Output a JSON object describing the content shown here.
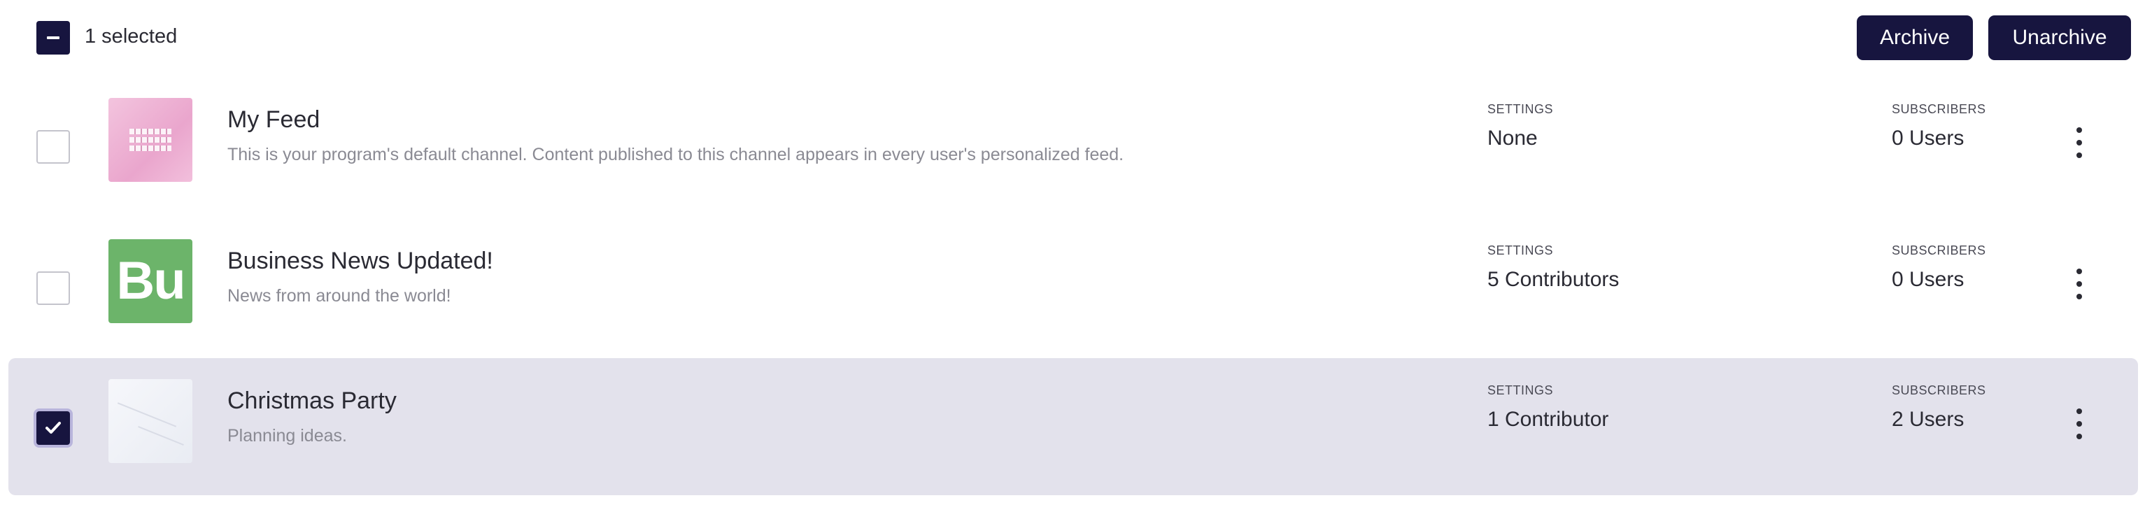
{
  "header": {
    "selected_label": "1 selected",
    "archive_label": "Archive",
    "unarchive_label": "Unarchive"
  },
  "columns": {
    "settings_label": "SETTINGS",
    "subscribers_label": "SUBSCRIBERS"
  },
  "rows": [
    {
      "title": "My Feed",
      "description": "This is your program's default channel. Content published to this channel appears in every user's personalized feed.",
      "settings": "None",
      "subscribers": "0 Users",
      "checked": false
    },
    {
      "title": "Business News Updated!",
      "description": "News from around the world!",
      "thumbnail_text": "Bu",
      "settings": "5 Contributors",
      "subscribers": "0 Users",
      "checked": false
    },
    {
      "title": "Christmas Party",
      "description": "Planning ideas.",
      "settings": "1 Contributor",
      "subscribers": "2 Users",
      "checked": true
    }
  ],
  "colors": {
    "primary": "#17153f",
    "selected_row_bg": "#e3e2ec",
    "business_thumb": "#6cb46a",
    "my_feed_thumb": "#eaa6cd"
  },
  "icons": {
    "bulk_select": "minus-icon",
    "row_checked": "checkmark-icon",
    "row_menu": "kebab-menu-icon"
  }
}
